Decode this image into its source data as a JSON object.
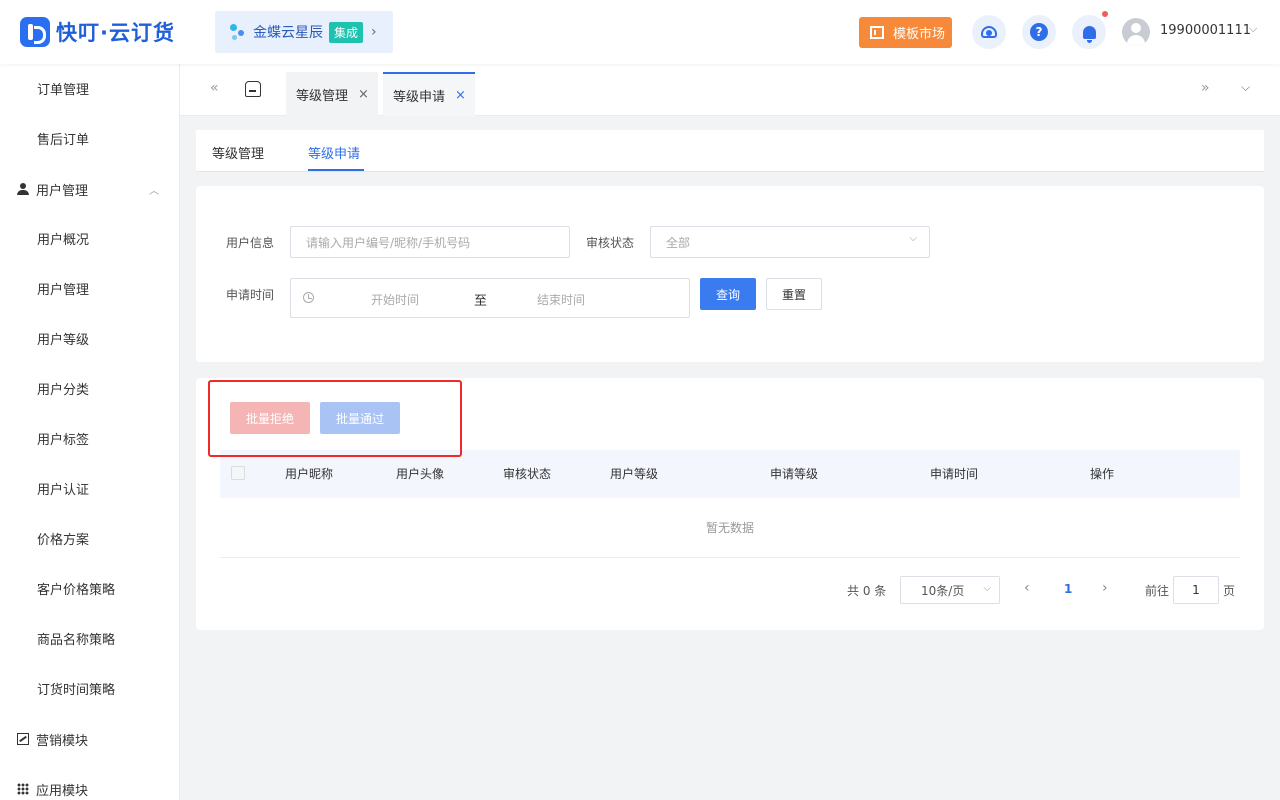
{
  "header": {
    "logo_text": "快叮·云订货",
    "kingdee": {
      "name": "金蝶云星辰",
      "badge": "集成",
      "arrow": "›"
    },
    "template_market": "模板市场",
    "help_glyph": "?",
    "username": "19900001111",
    "user_chevron": "⌵"
  },
  "sidebar": {
    "items": [
      {
        "label": "订单管理"
      },
      {
        "label": "售后订单"
      },
      {
        "label": "用户管理"
      },
      {
        "label": "用户概况"
      },
      {
        "label": "用户管理"
      },
      {
        "label": "用户等级"
      },
      {
        "label": "用户分类"
      },
      {
        "label": "用户标签"
      },
      {
        "label": "用户认证"
      },
      {
        "label": "价格方案"
      },
      {
        "label": "客户价格策略"
      },
      {
        "label": "商品名称策略"
      },
      {
        "label": "订货时间策略"
      },
      {
        "label": "营销模块"
      },
      {
        "label": "应用模块"
      }
    ],
    "collapse_glyph": "︿"
  },
  "tabbar": {
    "tabs": [
      {
        "label": "等级管理",
        "close": "×"
      },
      {
        "label": "等级申请",
        "close": "×"
      }
    ],
    "left_glyph": "«",
    "right_glyph": "»",
    "more_glyph": "⌵"
  },
  "subtabs": [
    "等级管理",
    "等级申请"
  ],
  "filter": {
    "user_info_label": "用户信息",
    "user_info_placeholder": "请输入用户编号/昵称/手机号码",
    "status_label": "审核状态",
    "status_value": "全部",
    "status_chevron": "⌵",
    "time_label": "申请时间",
    "start_placeholder": "开始时间",
    "range_sep": "至",
    "end_placeholder": "结束时间",
    "query_button": "查询",
    "reset_button": "重置"
  },
  "batch": {
    "reject": "批量拒绝",
    "approve": "批量通过",
    "reject_color": "#f5b5b5",
    "approve_color": "#a9c3f5"
  },
  "table": {
    "columns": [
      "用户昵称",
      "用户头像",
      "审核状态",
      "用户等级",
      "申请等级",
      "申请时间",
      "操作"
    ],
    "empty_text": "暂无数据"
  },
  "pagination": {
    "total": "共 0 条",
    "page_size": "10条/页",
    "page_size_chevron": "⌵",
    "prev": "‹",
    "current_page": "1",
    "next": "›",
    "goto_label": "前往",
    "goto_value": "1",
    "page_unit": "页"
  },
  "colors": {
    "accent": "#2f6ee8",
    "template_market": "#f7893b",
    "integration_badge": "#1ec3b0",
    "highlight_box": "#ee2a2a"
  }
}
